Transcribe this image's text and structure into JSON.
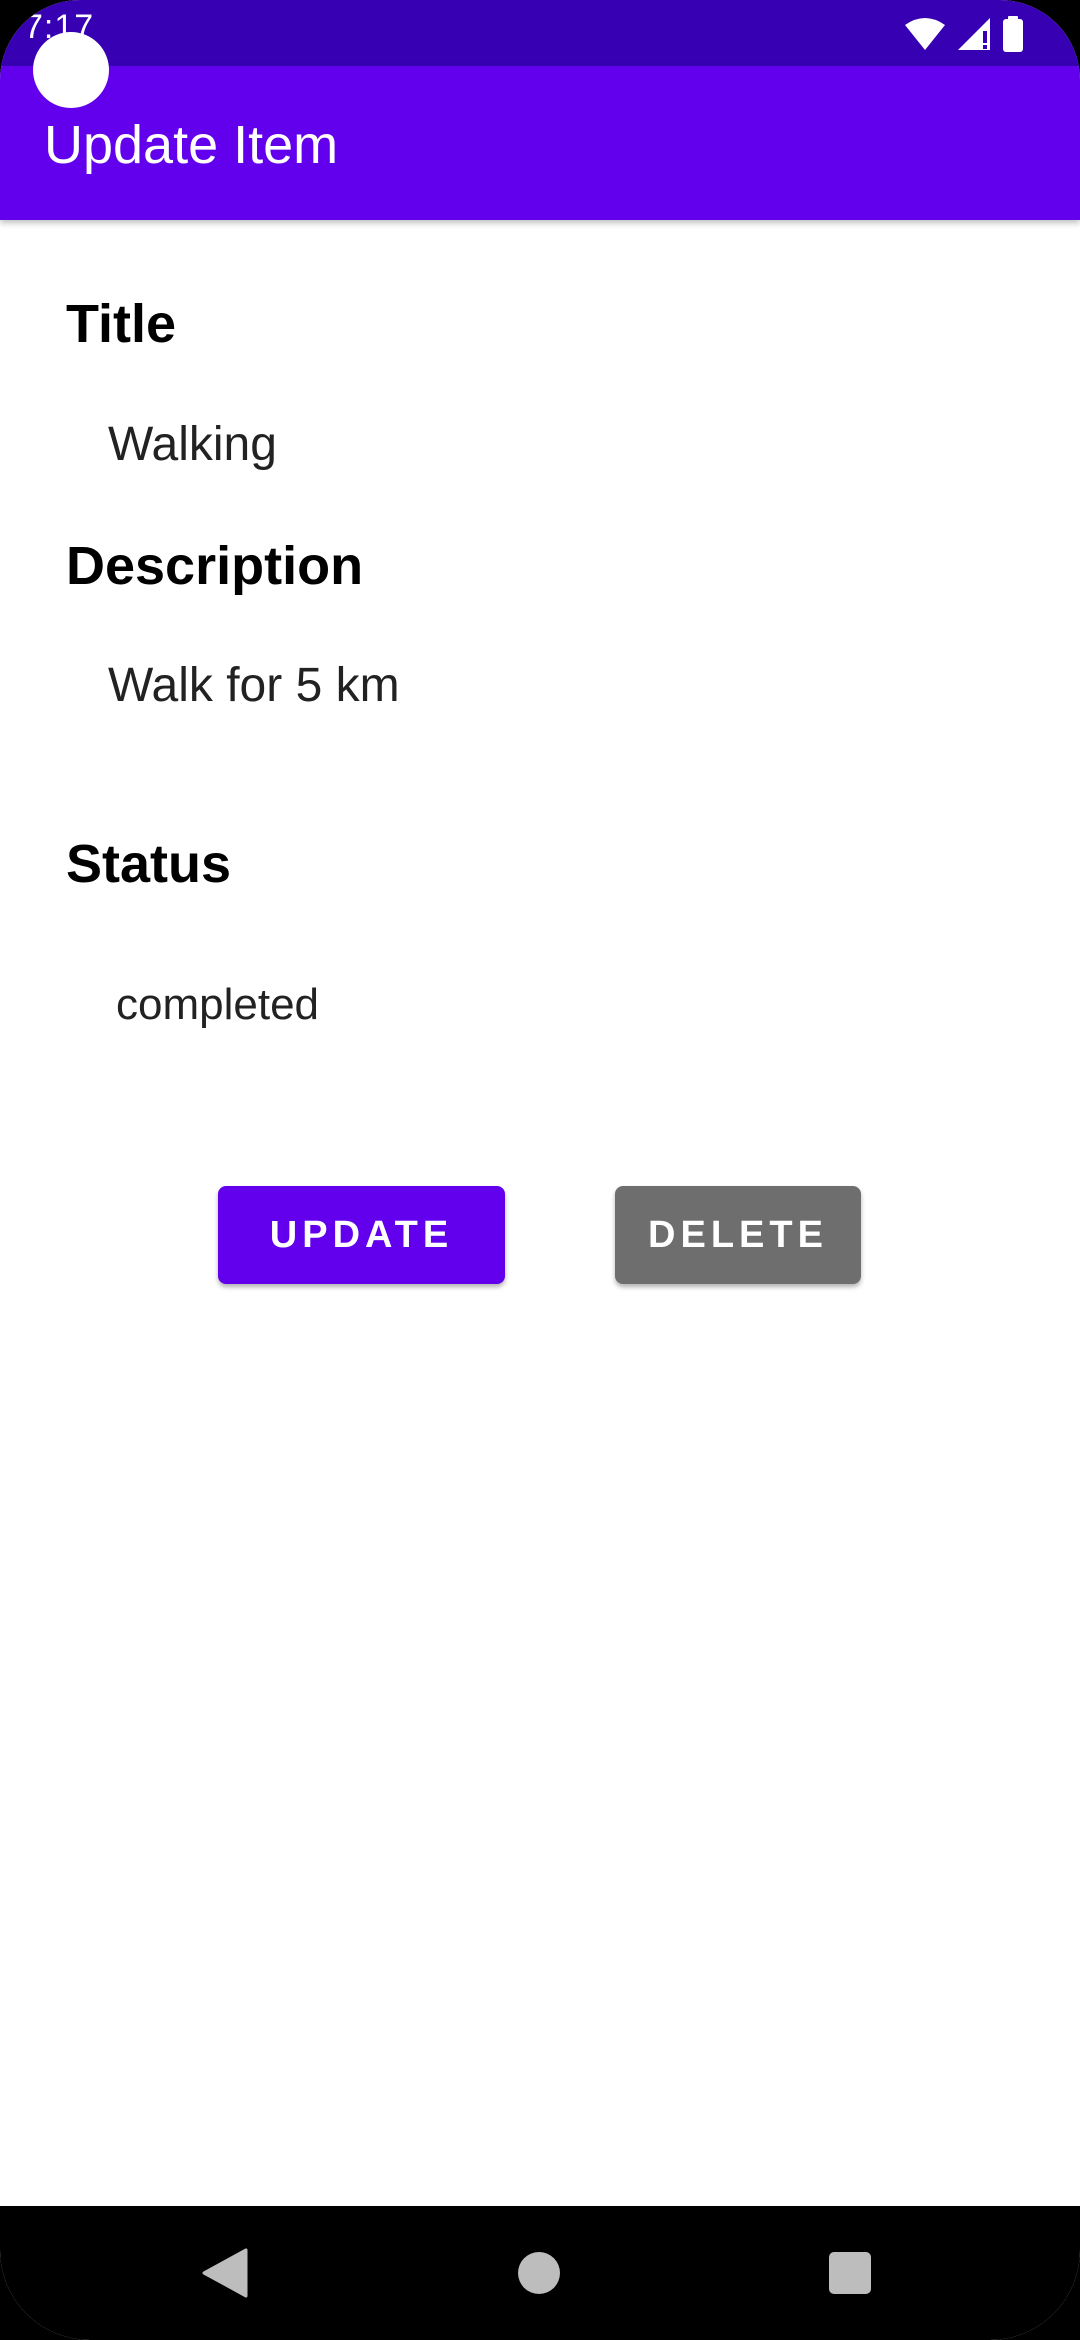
{
  "status_bar": {
    "time": "7:17",
    "icons": [
      "wifi-icon",
      "cellular-signal-icon",
      "battery-icon"
    ]
  },
  "app_bar": {
    "title": "Update Item"
  },
  "form": {
    "title_label": "Title",
    "title_value": "Walking",
    "description_label": "Description",
    "description_value": "Walk for 5 km",
    "status_label": "Status",
    "status_value": "completed"
  },
  "buttons": {
    "update_label": "UPDATE",
    "delete_label": "DELETE"
  },
  "nav_bar": {
    "icons": [
      "back-icon",
      "home-icon",
      "recents-icon"
    ]
  },
  "colors": {
    "status_bar": "#3700b3",
    "app_bar": "#6200ee",
    "update_button": "#6200ee",
    "delete_button": "#6e6e6e",
    "background": "#ffffff",
    "nav_bar": "#000000"
  }
}
